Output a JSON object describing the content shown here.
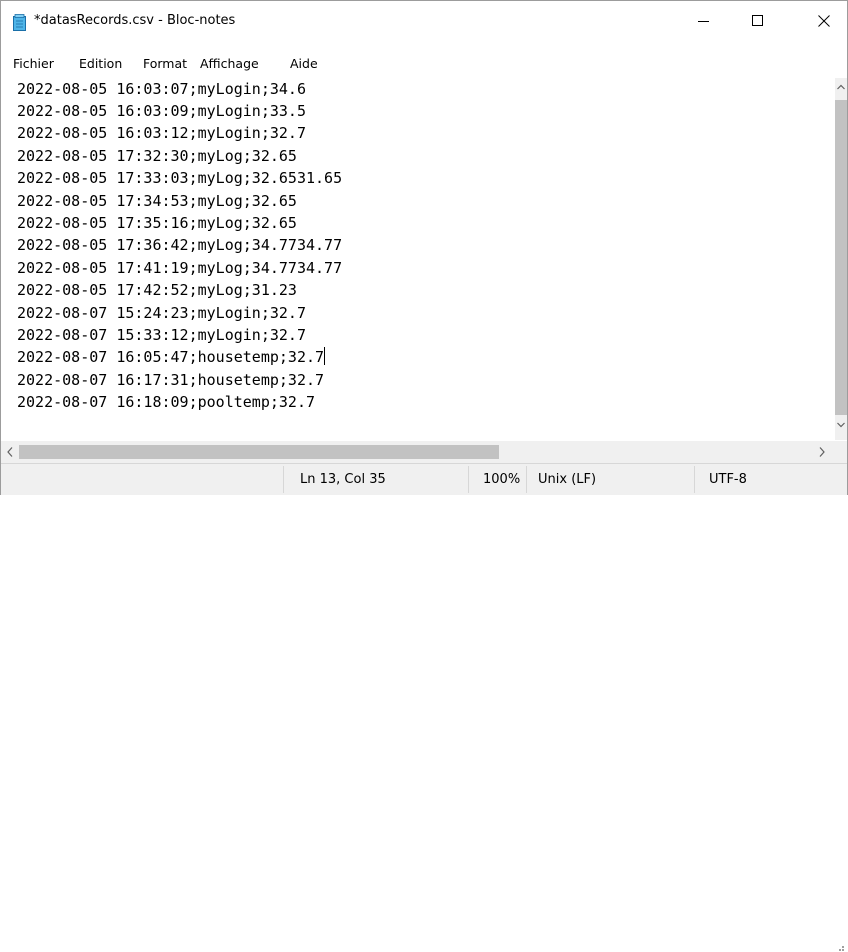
{
  "window": {
    "title": "*datasRecords.csv - Bloc-notes"
  },
  "menu": {
    "items": [
      "Fichier",
      "Edition",
      "Format",
      "Affichage",
      "Aide"
    ]
  },
  "editor": {
    "lines": [
      "2022-08-05 16:03:07;myLogin;34.6",
      "2022-08-05 16:03:09;myLogin;33.5",
      "2022-08-05 16:03:12;myLogin;32.7",
      "2022-08-05 17:32:30;myLog;32.65",
      "2022-08-05 17:33:03;myLog;32.6531.65",
      "2022-08-05 17:34:53;myLog;32.65",
      "2022-08-05 17:35:16;myLog;32.65",
      "2022-08-05 17:36:42;myLog;34.7734.77",
      "2022-08-05 17:41:19;myLog;34.7734.77",
      "2022-08-05 17:42:52;myLog;31.23",
      "2022-08-07 15:24:23;myLogin;32.7",
      "2022-08-07 15:33:12;myLogin;32.7",
      "2022-08-07 16:05:47;housetemp;32.7",
      "2022-08-07 16:17:31;housetemp;32.7",
      "2022-08-07 16:18:09;pooltemp;32.7"
    ],
    "caret_line": 13,
    "caret_column": 35
  },
  "status": {
    "position": "Ln 13, Col 35",
    "zoom": "100%",
    "line_ending": "Unix (LF)",
    "encoding": "UTF-8"
  },
  "icons": {
    "app": "notepad-icon",
    "minimize": "minimize-icon",
    "maximize": "maximize-icon",
    "close": "close-icon"
  },
  "colors": {
    "statusbar_bg": "#f0f0f0",
    "scrollbar_thumb": "#c2c2c2",
    "text": "#000000"
  }
}
